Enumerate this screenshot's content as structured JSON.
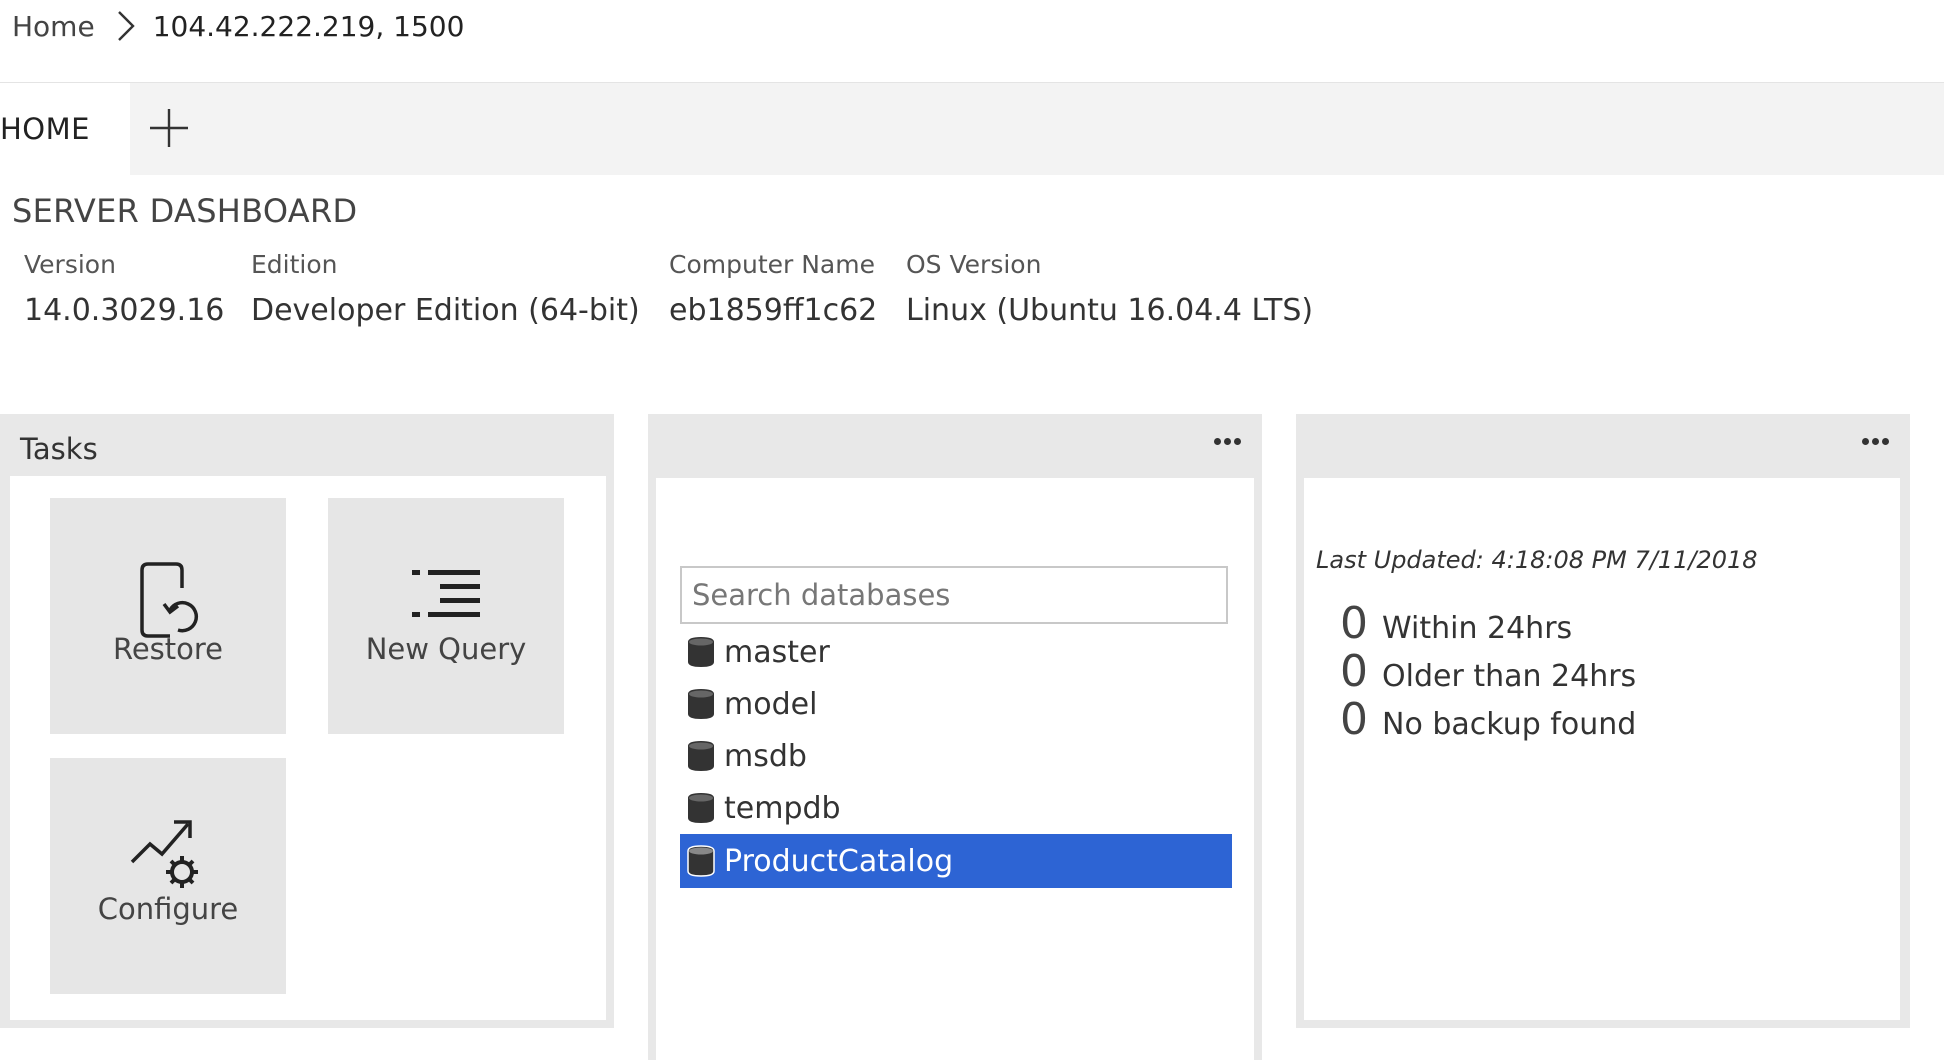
{
  "breadcrumb": {
    "home": "Home",
    "server": "104.42.222.219, 1500"
  },
  "tabs": {
    "home": "HOME",
    "add_icon": "plus-icon"
  },
  "dashboard": {
    "title": "SERVER DASHBOARD",
    "properties": [
      {
        "label": "Version",
        "value": "14.0.3029.16"
      },
      {
        "label": "Edition",
        "value": "Developer Edition (64-bit)"
      },
      {
        "label": "Computer Name",
        "value": "eb1859ff1c62"
      },
      {
        "label": "OS Version",
        "value": "Linux (Ubuntu 16.04.4 LTS)"
      }
    ]
  },
  "tasks": {
    "title": "Tasks",
    "items": [
      {
        "label": "Restore",
        "icon": "restore-icon"
      },
      {
        "label": "New Query",
        "icon": "new-query-icon"
      },
      {
        "label": "Configure",
        "icon": "configure-icon"
      }
    ]
  },
  "databases": {
    "search_placeholder": "Search databases",
    "items": [
      {
        "name": "master",
        "selected": false
      },
      {
        "name": "model",
        "selected": false
      },
      {
        "name": "msdb",
        "selected": false
      },
      {
        "name": "tempdb",
        "selected": false
      },
      {
        "name": "ProductCatalog",
        "selected": true
      }
    ],
    "selected_color": "#2d64d4"
  },
  "backup": {
    "last_updated": "Last Updated: 4:18:08 PM 7/11/2018",
    "stats": [
      {
        "count": "0",
        "label": "Within 24hrs"
      },
      {
        "count": "0",
        "label": "Older than 24hrs"
      },
      {
        "count": "0",
        "label": "No backup found"
      }
    ]
  }
}
